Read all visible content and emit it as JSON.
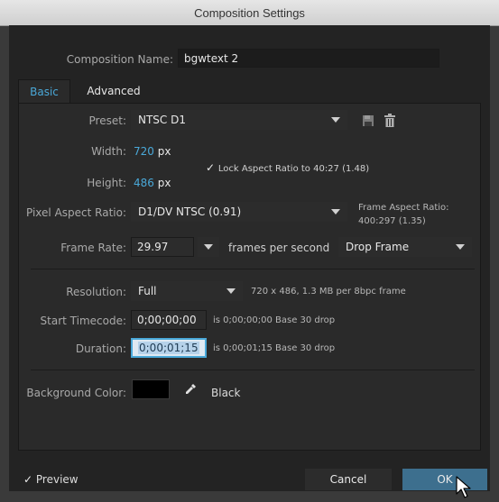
{
  "window": {
    "title": "Composition Settings"
  },
  "composition_name": {
    "label": "Composition Name:",
    "value": "bgwtext 2"
  },
  "tabs": [
    {
      "label": "Basic"
    },
    {
      "label": "Advanced"
    }
  ],
  "preset": {
    "label": "Preset:",
    "value": "NTSC D1"
  },
  "width": {
    "label": "Width:",
    "value": "720",
    "unit": "px"
  },
  "height": {
    "label": "Height:",
    "value": "486",
    "unit": "px"
  },
  "lock_aspect": {
    "checkmark": "✓",
    "label": "Lock Aspect Ratio to 40:27 (1.48)",
    "checked": true
  },
  "pixel_aspect": {
    "label": "Pixel Aspect Ratio:",
    "value": "D1/DV NTSC (0.91)"
  },
  "frame_aspect": {
    "label": "Frame Aspect Ratio:",
    "value": "400:297 (1.35)"
  },
  "frame_rate": {
    "label": "Frame Rate:",
    "value": "29.97",
    "suffix": "frames per second",
    "drop_frame": "Drop Frame"
  },
  "resolution": {
    "label": "Resolution:",
    "value": "Full",
    "info": "720 x 486, 1.3 MB per 8bpc frame"
  },
  "start_timecode": {
    "label": "Start Timecode:",
    "value": "0;00;00;00",
    "info": "is 0;00;00;00  Base 30  drop"
  },
  "duration": {
    "label": "Duration:",
    "value": "0;00;01;15",
    "info": "is 0;00;01;15  Base 30  drop"
  },
  "background_color": {
    "label": "Background Color:",
    "swatch": "#000000",
    "name": "Black"
  },
  "footer": {
    "preview_check": "✓",
    "preview_label": "Preview",
    "preview_checked": true,
    "cancel_label": "Cancel",
    "ok_label": "OK"
  },
  "colors": {
    "accent": "#4aa8d8",
    "ok_button": "#3d6f8e",
    "dialog_bg": "#232323"
  },
  "icons": [
    "save-preset-icon",
    "trash-icon",
    "eyedropper-icon",
    "mouse-cursor-icon"
  ]
}
